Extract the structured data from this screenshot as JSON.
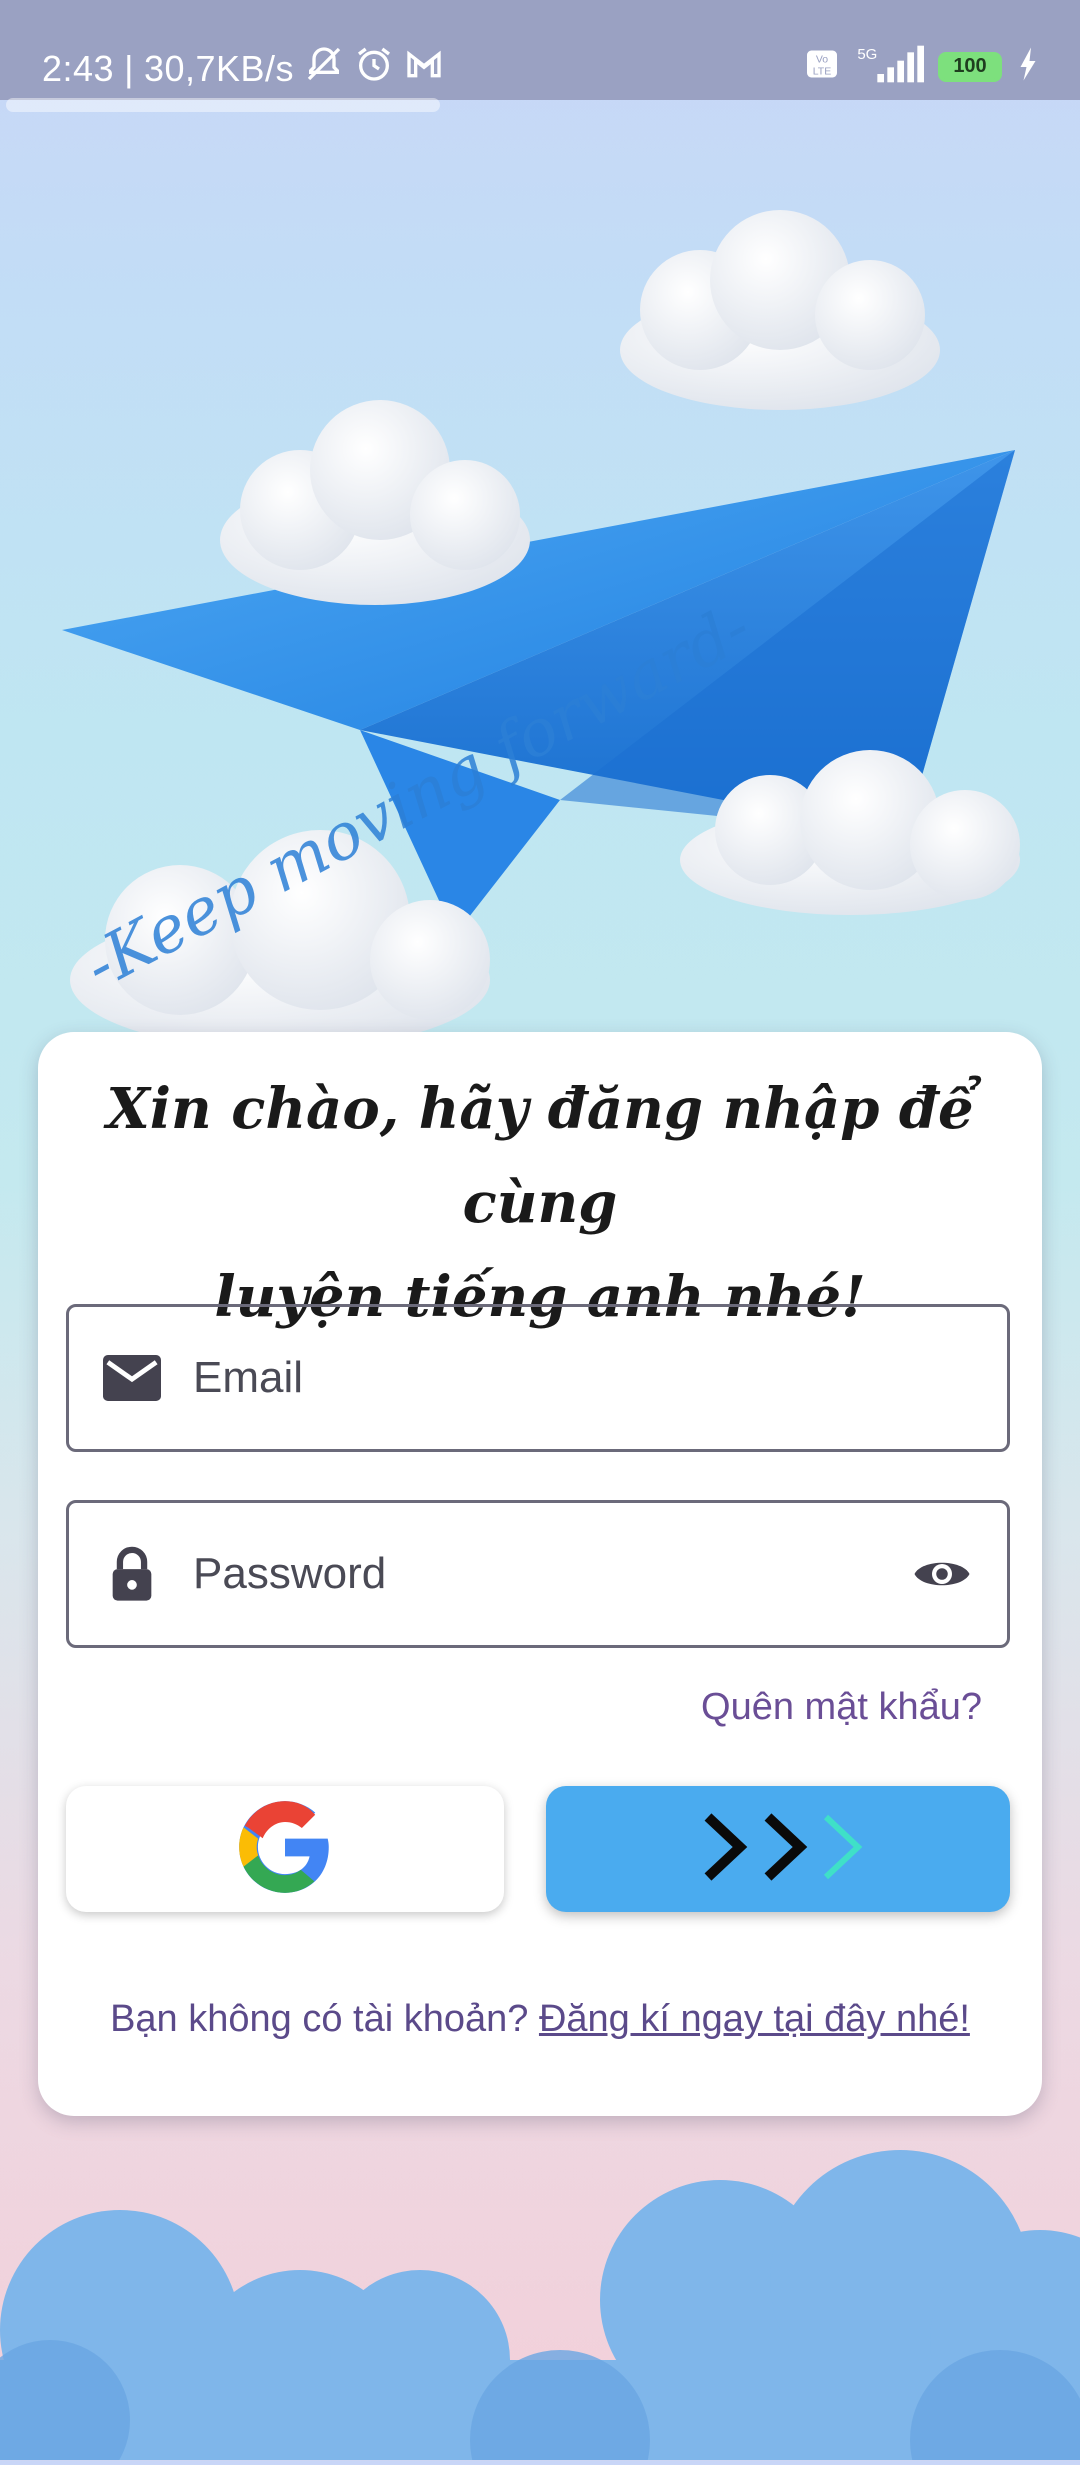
{
  "status_bar": {
    "time": "2:43",
    "network_speed": "30,7KB/s",
    "signal_label": "5G",
    "volte_label": "Vo LTE",
    "battery": "100",
    "icons": [
      "mute-icon",
      "alarm-icon",
      "gmail-icon",
      "volte-icon",
      "signal-icon",
      "battery-icon",
      "charging-icon"
    ]
  },
  "hero": {
    "tagline": "-Keep moving forward-"
  },
  "login": {
    "title_line1": "Xin chào, hãy đăng nhập để cùng",
    "title_line2": "luyện tiếng anh nhé!",
    "email_placeholder": "Email",
    "password_placeholder": "Password",
    "forgot_password": "Quên mật khẩu?",
    "signup_prompt": "Bạn không có tài khoản? ",
    "signup_link": "Đăng kí ngay tại đây nhé!",
    "icons": {
      "email": "mail-icon",
      "password": "lock-icon",
      "visibility": "eye-icon",
      "google": "google-icon",
      "next": "double-chevron-right-icon"
    }
  },
  "colors": {
    "accent": "#4aabef",
    "link": "#6a4e96",
    "status_bar": "#9aa1c2"
  }
}
